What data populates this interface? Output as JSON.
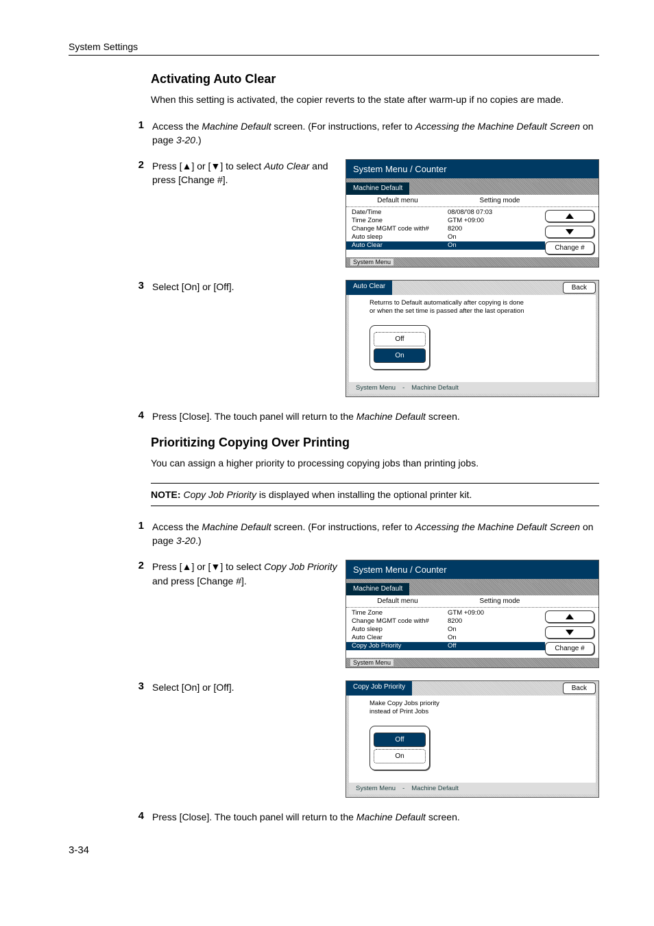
{
  "running_head": "System Settings",
  "page_number": "3-34",
  "sec1": {
    "title": "Activating Auto Clear",
    "intro": "When this setting is activated, the copier reverts to the state after warm-up if no copies are made.",
    "steps": {
      "s1": {
        "num": "1",
        "a": "Access the ",
        "b": "Machine Default",
        "c": " screen. (For instructions, refer to ",
        "d": "Accessing the Machine Default Screen",
        "e": " on page ",
        "f": "3-20",
        "g": ".)"
      },
      "s2": {
        "num": "2",
        "a": "Press [",
        "b": "] or [",
        "c": "] to select ",
        "d": "Auto Clear",
        "e": " and press [Change #]."
      },
      "s3": {
        "num": "3",
        "text": "Select [On] or [Off]."
      },
      "s4": {
        "num": "4",
        "a": "Press [Close]. The touch panel will return to the ",
        "b": "Machine Default",
        "c": " screen."
      }
    }
  },
  "sec2": {
    "title": "Prioritizing Copying Over Printing",
    "intro": "You can assign a higher priority to processing copying jobs than printing jobs.",
    "note_label": "NOTE:",
    "note_a": " ",
    "note_b": "Copy Job Priority",
    "note_c": " is displayed when installing the optional printer kit.",
    "steps": {
      "s1": {
        "num": "1",
        "a": "Access the ",
        "b": "Machine Default",
        "c": " screen. (For instructions, refer to ",
        "d": "Accessing the Machine Default Screen",
        "e": " on page ",
        "f": "3-20",
        "g": ".)"
      },
      "s2": {
        "num": "2",
        "a": "Press [",
        "b": "] or [",
        "c": "] to select ",
        "d": "Copy Job Priority",
        "e": " and press [Change #]."
      },
      "s3": {
        "num": "3",
        "text": "Select [On] or [Off]."
      },
      "s4": {
        "num": "4",
        "a": "Press [Close]. The touch panel will return to the ",
        "b": "Machine Default",
        "c": " screen."
      }
    }
  },
  "panel_common": {
    "title": "System Menu / Counter",
    "tab": "Machine Default",
    "col1": "Default menu",
    "col2": "Setting mode",
    "change": "Change #",
    "footer": "System Menu"
  },
  "panel1_rows": [
    {
      "k": "Date/Time",
      "v": "08/08/'08 07:03"
    },
    {
      "k": "Time Zone",
      "v": "GTM +09:00"
    },
    {
      "k": "Change MGMT code with#",
      "v": "8200"
    },
    {
      "k": "Auto sleep",
      "v": "On"
    },
    {
      "k": "Auto Clear",
      "v": "On",
      "sel": true
    }
  ],
  "panel3_rows": [
    {
      "k": "Time Zone",
      "v": "GTM +09:00"
    },
    {
      "k": "Change MGMT code with#",
      "v": "8200"
    },
    {
      "k": "Auto sleep",
      "v": "On"
    },
    {
      "k": "Auto Clear",
      "v": "On"
    },
    {
      "k": "Copy Job Priority",
      "v": "Off",
      "sel": true
    }
  ],
  "dlg1": {
    "title": "Auto Clear",
    "back": "Back",
    "desc": "Returns to Default automatically after copying is done\nor when the set time is passed after the last operation",
    "off": "Off",
    "on": "On",
    "on_selected": true,
    "foot1": "System Menu",
    "foot_sep": "-",
    "foot2": "Machine Default"
  },
  "dlg2": {
    "title": "Copy Job Priority",
    "back": "Back",
    "desc": "Make Copy Jobs priority\ninstead of Print Jobs",
    "off": "Off",
    "on": "On",
    "off_selected": true,
    "foot1": "System Menu",
    "foot_sep": "-",
    "foot2": "Machine Default"
  }
}
